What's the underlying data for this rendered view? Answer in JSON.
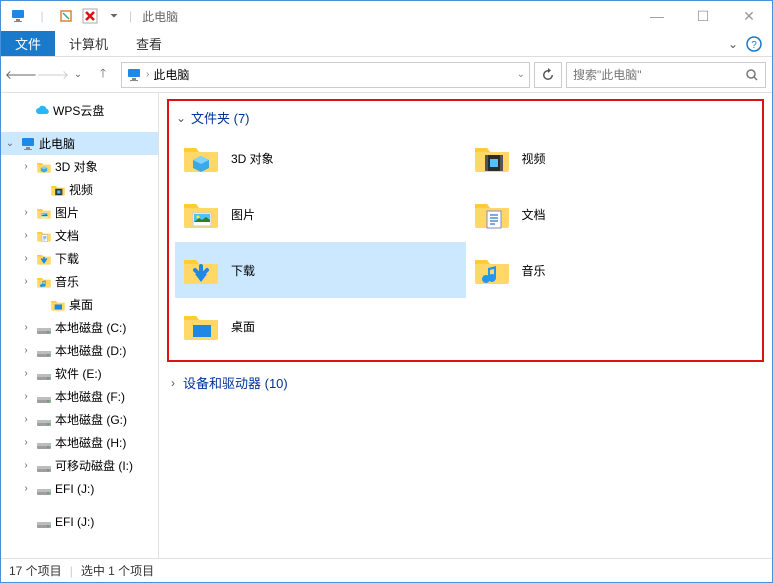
{
  "title": "此电脑",
  "ribbon": {
    "file": "文件",
    "computer": "计算机",
    "view": "查看"
  },
  "breadcrumb": {
    "location": "此电脑"
  },
  "search": {
    "placeholder": "搜索\"此电脑\""
  },
  "sidebar": {
    "items": [
      {
        "label": "WPS云盘",
        "chev": "",
        "indent": 16,
        "icon": "cloud"
      },
      {
        "label": "此电脑",
        "chev": "⌄",
        "indent": 2,
        "icon": "pc",
        "selected": true
      },
      {
        "label": "3D 对象",
        "chev": "›",
        "indent": 18,
        "icon": "cube"
      },
      {
        "label": "视频",
        "chev": "",
        "indent": 32,
        "icon": "video"
      },
      {
        "label": "图片",
        "chev": "›",
        "indent": 18,
        "icon": "picture"
      },
      {
        "label": "文档",
        "chev": "›",
        "indent": 18,
        "icon": "doc"
      },
      {
        "label": "下载",
        "chev": "›",
        "indent": 18,
        "icon": "download"
      },
      {
        "label": "音乐",
        "chev": "›",
        "indent": 18,
        "icon": "music"
      },
      {
        "label": "桌面",
        "chev": "",
        "indent": 32,
        "icon": "desktop"
      },
      {
        "label": "本地磁盘 (C:)",
        "chev": "›",
        "indent": 18,
        "icon": "drive"
      },
      {
        "label": "本地磁盘 (D:)",
        "chev": "›",
        "indent": 18,
        "icon": "drive"
      },
      {
        "label": "软件 (E:)",
        "chev": "›",
        "indent": 18,
        "icon": "drive"
      },
      {
        "label": "本地磁盘 (F:)",
        "chev": "›",
        "indent": 18,
        "icon": "drive"
      },
      {
        "label": "本地磁盘 (G:)",
        "chev": "›",
        "indent": 18,
        "icon": "drive"
      },
      {
        "label": "本地磁盘 (H:)",
        "chev": "›",
        "indent": 18,
        "icon": "drive"
      },
      {
        "label": "可移动磁盘 (I:)",
        "chev": "›",
        "indent": 18,
        "icon": "drive"
      },
      {
        "label": "EFI (J:)",
        "chev": "›",
        "indent": 18,
        "icon": "drive"
      },
      {
        "label": "EFI (J:)",
        "chev": "",
        "indent": 18,
        "icon": "drive"
      }
    ]
  },
  "groups": {
    "folders": {
      "title": "文件夹 (7)",
      "expanded": true
    },
    "devices": {
      "title": "设备和驱动器 (10)",
      "expanded": false
    }
  },
  "folders": [
    {
      "label": "3D 对象",
      "icon": "cube"
    },
    {
      "label": "视频",
      "icon": "video"
    },
    {
      "label": "图片",
      "icon": "picture"
    },
    {
      "label": "文档",
      "icon": "doc"
    },
    {
      "label": "下载",
      "icon": "download",
      "selected": true
    },
    {
      "label": "音乐",
      "icon": "music"
    },
    {
      "label": "桌面",
      "icon": "desktop"
    }
  ],
  "status": {
    "items": "17 个项目",
    "selected": "选中 1 个项目"
  }
}
